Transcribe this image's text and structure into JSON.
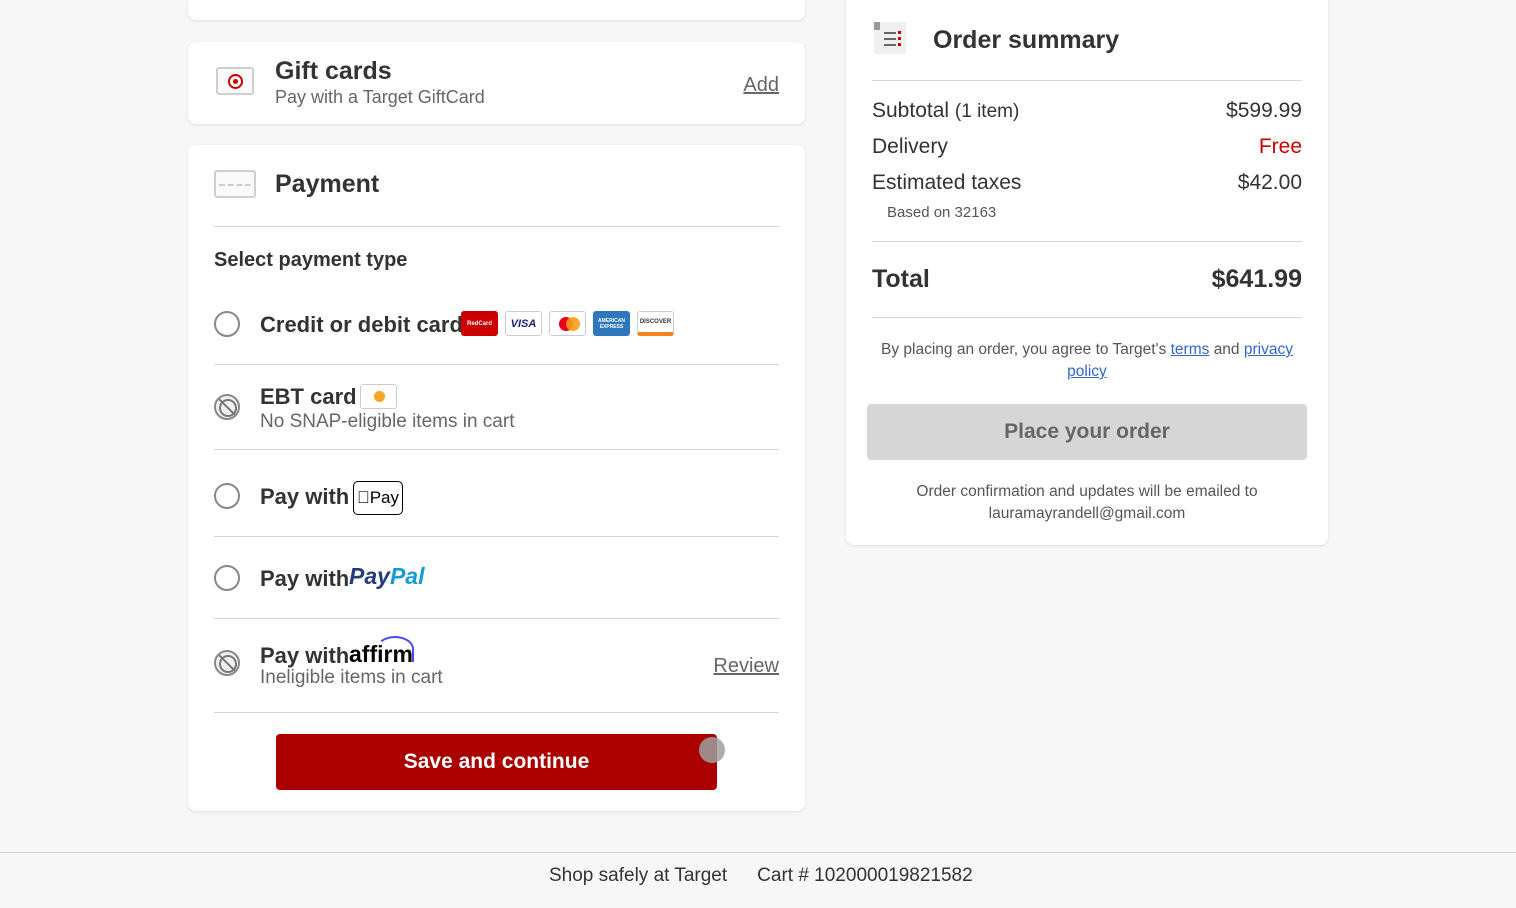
{
  "gift_cards": {
    "title": "Gift cards",
    "subtitle": "Pay with a Target GiftCard",
    "add_label": "Add"
  },
  "payment": {
    "title": "Payment",
    "select_label": "Select payment type",
    "options": [
      {
        "label": "Credit or debit card",
        "enabled": true,
        "logos": [
          "RedCard",
          "VISA",
          "mastercard",
          "AMERICAN EXPRESS",
          "DISCOVER"
        ]
      },
      {
        "label": "EBT card",
        "sub": "No SNAP-eligible items in cart",
        "enabled": false
      },
      {
        "label": "Pay with",
        "brand": "Pay",
        "enabled": true
      },
      {
        "label": "Pay with",
        "brand_a": "Pay",
        "brand_b": "Pal",
        "enabled": true
      },
      {
        "label": "Pay with",
        "brand": "affirm",
        "sub": "Ineligible items in cart",
        "enabled": false,
        "link": "Review"
      }
    ],
    "save_label": "Save and continue"
  },
  "summary": {
    "title": "Order summary",
    "subtitle_label": "Subtotal",
    "subtitle_count": "(1 item)",
    "subtotal": "$599.99",
    "delivery_label": "Delivery",
    "delivery_value": "Free",
    "tax_label": "Estimated taxes",
    "tax_value": "$42.00",
    "based_on": "Based on 32163",
    "total_label": "Total",
    "total_value": "$641.99",
    "agree_prefix": "By placing an order, you agree to Target's",
    "terms_link": "terms",
    "agree_and": "and",
    "privacy_link": "privacy policy",
    "place_label": "Place your order",
    "confirm_text": "Order confirmation and updates will be emailed to",
    "email": "lauramayrandell@gmail.com"
  },
  "footer": {
    "shop_safely": "Shop safely at Target",
    "cart_number": "Cart # 102000019821582"
  },
  "colors": {
    "brand_red": "#aa0000",
    "free_red": "#cc0000",
    "link_blue": "#3366cc"
  }
}
